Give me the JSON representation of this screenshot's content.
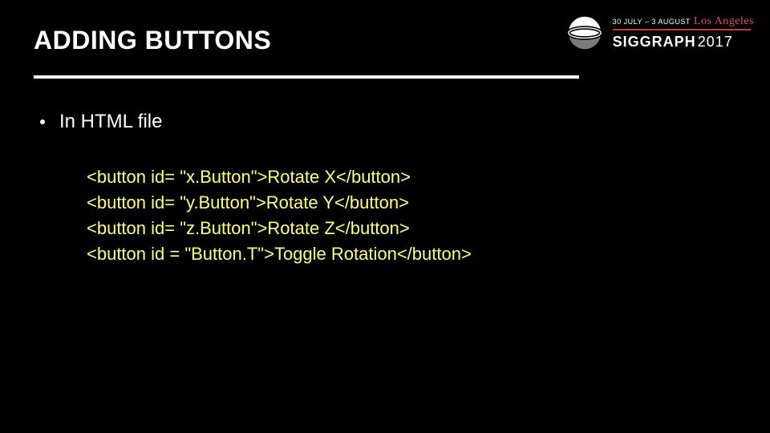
{
  "title": "ADDING BUTTONS",
  "bullet": "In HTML file",
  "code": {
    "l1": "<button id= \"x.Button\">Rotate X</button>",
    "l2": "<button id= \"y.Button\">Rotate Y</button>",
    "l3": "<button id= \"z.Button\">Rotate Z</button>",
    "l4": "<button id = \"Button.T\">Toggle Rotation</button>"
  },
  "header": {
    "date_text": "30 JULY – 3 AUGUST",
    "city": "Los Angeles",
    "brand": "SIGGRAPH",
    "year": "2017"
  }
}
